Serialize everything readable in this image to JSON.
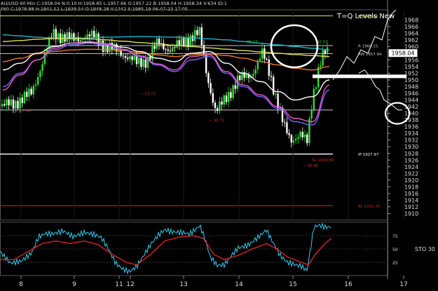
{
  "header": {
    "line1": "AU/USD 60 Min  C:1958.04  N:0.10  H:1958.85  L:1957.66  O:1957.22  B:1958.04  H:1958.34  V:634  ID:1",
    "line2": "F60  C:1978.88  H:1941.52  L:1939.54  O:1948.28  V:1342  S:1985.19  06-07-23  17:05"
  },
  "annotation_title": "T=Q Levels New",
  "price_tag": "1958.04",
  "chart_data": {
    "type": "line",
    "price_axis": {
      "ylim": [
        1908,
        1971
      ],
      "ticks": [
        1968,
        1966,
        1964,
        1962,
        1960,
        1958,
        1956,
        1954,
        1952,
        1950,
        1948,
        1946,
        1944,
        1942,
        1940,
        1938,
        1936,
        1934,
        1932,
        1930,
        1928,
        1926,
        1924,
        1922,
        1920,
        1918,
        1916,
        1914,
        1912,
        1910
      ]
    },
    "x_axis": {
      "tick_labels": [
        "8",
        "9",
        "11",
        "12",
        "13",
        "14",
        "15",
        "16",
        "17"
      ]
    },
    "levels": [
      {
        "price": 1969.2,
        "color": "#e6e63c",
        "label": "H 1969.61"
      },
      {
        "price": 1960.3,
        "color": "#cccccc",
        "label": "R 1960.15"
      },
      {
        "price": 1957.9,
        "color": "#cccccc",
        "label": "RW 1957.94"
      },
      {
        "price": 1941.0,
        "color": "#cccccc",
        "label": ""
      },
      {
        "price": 1927.8,
        "color": "#ffffff",
        "label": "IP 1927.97"
      },
      {
        "price": 1912.3,
        "color": "#d02020",
        "label": "BL 1912.35"
      }
    ],
    "small_labels": [
      {
        "text": "27.45",
        "price": 1940.3,
        "color": "#d03030"
      },
      {
        "text": "23.72",
        "price": 1945.5,
        "color": "#d03030"
      },
      {
        "text": "30.71",
        "price": 1937.5,
        "color": "#d03030"
      },
      {
        "text": "20.17",
        "price": 1961.0,
        "color": "#33dd33"
      },
      {
        "text": "32.53",
        "price": 1961.0,
        "color": "#33dd33"
      },
      {
        "text": "35.46",
        "price": 1924.0,
        "color": "#d03030"
      },
      {
        "text": "SL 1924.90",
        "price": 1925.6,
        "color": "#d03030"
      }
    ],
    "stochastic": {
      "label": "STO 30",
      "ylim": [
        0,
        100
      ],
      "ticks": [
        75,
        50,
        25
      ],
      "fast_color": "#33ccee",
      "slow_color": "#dd2222"
    },
    "series": [
      {
        "name": "",
        "color": "#11bbcc",
        "values": [
          1963.5,
          1963.2,
          1962.8,
          1962.5,
          1962.3,
          1962.6,
          1962.8,
          1962.9,
          1963.0,
          1962.9,
          1962.8,
          1962.6,
          1962.3,
          1962.0,
          1961.5,
          1961.0,
          1960.5,
          1960.0,
          1959.5,
          1959.0
        ]
      },
      {
        "name": "",
        "color": "#dddd55",
        "values": [
          1961.5,
          1961.8,
          1962.2,
          1962.4,
          1962.5,
          1962.3,
          1962.0,
          1961.6,
          1961.2,
          1960.8,
          1960.4,
          1960.0,
          1959.6,
          1959.2,
          1958.8,
          1958.4,
          1958.0,
          1957.6,
          1957.3,
          1957.0
        ]
      },
      {
        "name": "",
        "color": "#ee7722",
        "values": [
          1955.5,
          1956.5,
          1957.8,
          1958.5,
          1959.0,
          1959.2,
          1959.1,
          1958.8,
          1958.2,
          1957.5,
          1957.0,
          1957.5,
          1957.8,
          1957.3,
          1956.5,
          1955.5,
          1954.5,
          1953.5,
          1953.0,
          1954.0
        ]
      },
      {
        "name": "",
        "color": "#ffffff",
        "values": [
          1953.0,
          1955.0,
          1958.0,
          1960.0,
          1961.0,
          1961.3,
          1960.8,
          1959.8,
          1958.5,
          1956.5,
          1955.5,
          1958.0,
          1958.5,
          1955.0,
          1952.0,
          1949.5,
          1946.5,
          1944.0,
          1945.0,
          1950.0
        ]
      },
      {
        "name": "",
        "color": "#7766ff",
        "values": [
          1948.0,
          1952.0,
          1956.0,
          1959.0,
          1960.5,
          1961.0,
          1960.5,
          1959.0,
          1957.0,
          1954.5,
          1952.5,
          1956.0,
          1957.0,
          1952.0,
          1948.0,
          1945.0,
          1941.5,
          1937.5,
          1936.5,
          1947.0
        ]
      },
      {
        "name": "",
        "color": "#ee55cc",
        "values": [
          1947.0,
          1951.5,
          1956.0,
          1959.5,
          1961.0,
          1961.5,
          1960.8,
          1959.2,
          1957.2,
          1954.8,
          1953.0,
          1957.0,
          1957.5,
          1952.5,
          1948.5,
          1945.5,
          1942.0,
          1938.5,
          1937.5,
          1948.5
        ]
      }
    ]
  }
}
